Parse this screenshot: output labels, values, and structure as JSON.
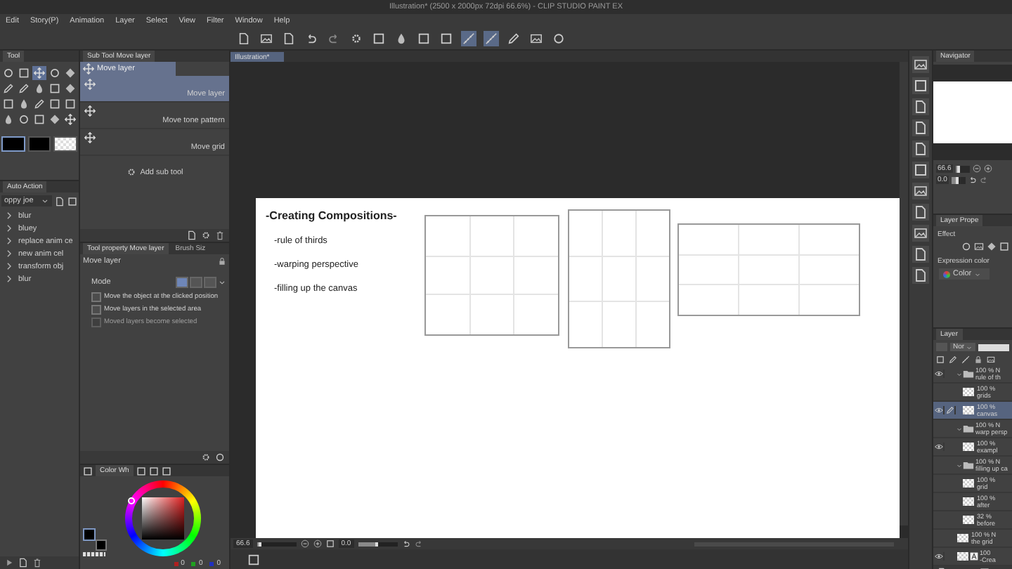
{
  "window": {
    "title": "Illustration* (2500 x 2000px 72dpi 66.6%) - CLIP STUDIO PAINT EX"
  },
  "menu": [
    "Edit",
    "Story(P)",
    "Animation",
    "Layer",
    "Select",
    "View",
    "Filter",
    "Window",
    "Help"
  ],
  "tool_panel": {
    "title": "Tool",
    "tools": [
      {
        "kind": "circle",
        "selected": false
      },
      {
        "kind": "square",
        "selected": false
      },
      {
        "kind": "cross",
        "selected": true
      },
      {
        "kind": "circle",
        "selected": false
      },
      {
        "kind": "diamond",
        "selected": false
      },
      {
        "kind": "pen",
        "selected": false
      },
      {
        "kind": "pen",
        "selected": false
      },
      {
        "kind": "drop",
        "selected": false
      },
      {
        "kind": "square",
        "selected": false
      },
      {
        "kind": "diamond",
        "selected": false
      },
      {
        "kind": "square",
        "selected": false
      },
      {
        "kind": "drop",
        "selected": false
      },
      {
        "kind": "pen",
        "selected": false
      },
      {
        "kind": "square",
        "selected": false
      },
      {
        "kind": "square",
        "selected": false
      },
      {
        "kind": "drop",
        "selected": false
      },
      {
        "kind": "circle",
        "selected": false
      },
      {
        "kind": "square",
        "selected": false
      },
      {
        "kind": "diamond",
        "selected": false
      },
      {
        "kind": "cross",
        "selected": false
      }
    ],
    "swatches": [
      {
        "kind": "solid",
        "selected": true
      },
      {
        "kind": "solid",
        "selected": false
      },
      {
        "kind": "transparent",
        "selected": false
      }
    ]
  },
  "auto_action": {
    "title": "Auto Action",
    "set": "oppy joe",
    "items": [
      "blur",
      "bluey",
      "replace anim ce",
      "new anim cel",
      "transform obj",
      "blur"
    ]
  },
  "sub_tool": {
    "title": "Sub Tool Move layer",
    "group": "Move layer",
    "items": [
      {
        "label": "Move layer",
        "selected": true
      },
      {
        "label": "Move tone pattern",
        "selected": false
      },
      {
        "label": "Move grid",
        "selected": false
      }
    ],
    "add": "Add sub tool"
  },
  "tool_property": {
    "tabs": [
      {
        "label": "Tool property Move layer",
        "selected": true
      },
      {
        "label": "Brush Siz",
        "selected": false
      }
    ],
    "title": "Move layer",
    "mode_label": "Mode",
    "modes": [
      {
        "selected": true
      },
      {
        "selected": false
      },
      {
        "selected": false
      }
    ],
    "options": [
      {
        "label": "Move the object at the clicked position",
        "checked": false,
        "disabled": false
      },
      {
        "label": "Move layers in the selected area",
        "checked": false,
        "disabled": false
      },
      {
        "label": "Moved layers become selected",
        "checked": false,
        "disabled": true
      }
    ]
  },
  "color_wheel": {
    "tab": "Color Wh",
    "readouts": [
      {
        "value": "0",
        "color": "#b02020"
      },
      {
        "value": "0",
        "color": "#20a020"
      },
      {
        "value": "0",
        "color": "#2030c0"
      }
    ]
  },
  "canvas": {
    "tab": "Illustration*",
    "heading": "-Creating Compositions-",
    "bullets": [
      "-rule of thirds",
      "-warping perspective",
      "-filling up the canvas"
    ],
    "zoom": "66.6",
    "rotation": "0.0",
    "zoom_slider": {
      "level": 0.12
    },
    "rotation_slider": {
      "level": 0.5
    }
  },
  "navigator": {
    "title": "Navigator",
    "zoom": "66.6",
    "angle": "0.0",
    "zoom_slider": {
      "level": 0.3
    },
    "angle_slider": {
      "level": 0.5
    }
  },
  "layer_property": {
    "title": "Layer Prope",
    "effect_label": "Effect",
    "expression_label": "Expression color",
    "expression_value": "Color"
  },
  "layers": {
    "title": "Layer",
    "blend": "Nor",
    "opacity_slider": {
      "level": 1
    },
    "items": [
      {
        "kind": "folder",
        "opacity": "100 % N",
        "name": "rule of th",
        "visible": true,
        "selected": false,
        "expanded": true,
        "children": [
          {
            "kind": "raster",
            "opacity": "100 %",
            "name": "grids",
            "visible": false,
            "selected": false
          },
          {
            "kind": "raster",
            "opacity": "100 %",
            "name": "canvas",
            "visible": true,
            "selected": true
          }
        ]
      },
      {
        "kind": "folder",
        "opacity": "100 % N",
        "name": "warp persp",
        "visible": false,
        "selected": false,
        "expanded": true,
        "children": [
          {
            "kind": "raster",
            "opacity": "100 %",
            "name": "exampl",
            "visible": true,
            "selected": false
          }
        ]
      },
      {
        "kind": "folder",
        "opacity": "100 % N",
        "name": "filling up ca",
        "visible": false,
        "selected": false,
        "expanded": true,
        "children": [
          {
            "kind": "raster",
            "opacity": "100 %",
            "name": "grid",
            "visible": false,
            "selected": false
          },
          {
            "kind": "raster",
            "opacity": "100 %",
            "name": "after",
            "visible": false,
            "selected": false
          },
          {
            "kind": "raster",
            "opacity": "32 %",
            "name": "before",
            "visible": false,
            "selected": false
          }
        ]
      },
      {
        "kind": "raster",
        "opacity": "100 % N",
        "name": "the grid",
        "visible": false,
        "selected": false
      },
      {
        "kind": "text",
        "opacity": "100",
        "name": "-Crea",
        "visible": true,
        "selected": false
      }
    ]
  }
}
